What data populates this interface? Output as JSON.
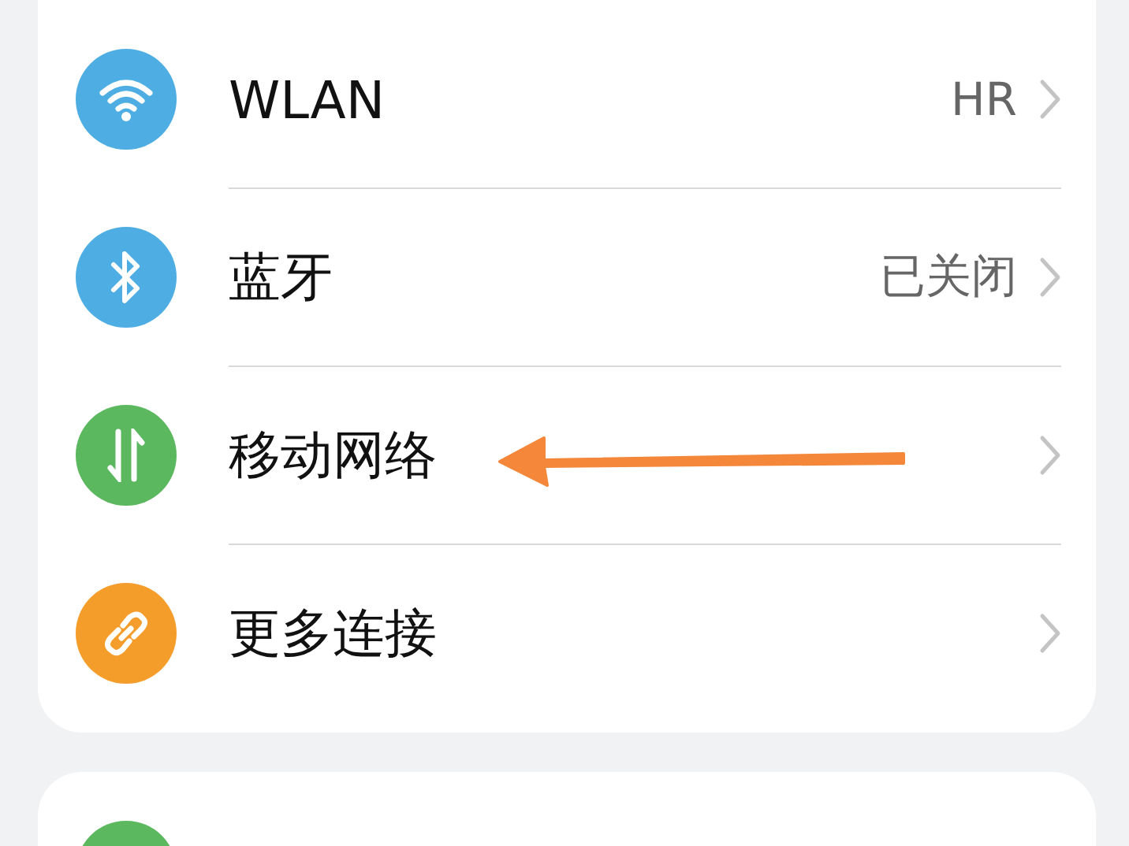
{
  "cards": [
    {
      "items": [
        {
          "kind": "wifi",
          "color": "#4eaee3",
          "label": "WLAN",
          "value": "HR"
        },
        {
          "kind": "bluetooth",
          "color": "#4eaee3",
          "label": "蓝牙",
          "value": "已关闭"
        },
        {
          "kind": "data",
          "color": "#5cb85f",
          "label": "移动网络"
        },
        {
          "kind": "link",
          "color": "#f59d2a",
          "label": "更多连接"
        }
      ]
    },
    {
      "items": [
        {
          "kind": "square",
          "color": "#5cb85f"
        }
      ]
    }
  ]
}
